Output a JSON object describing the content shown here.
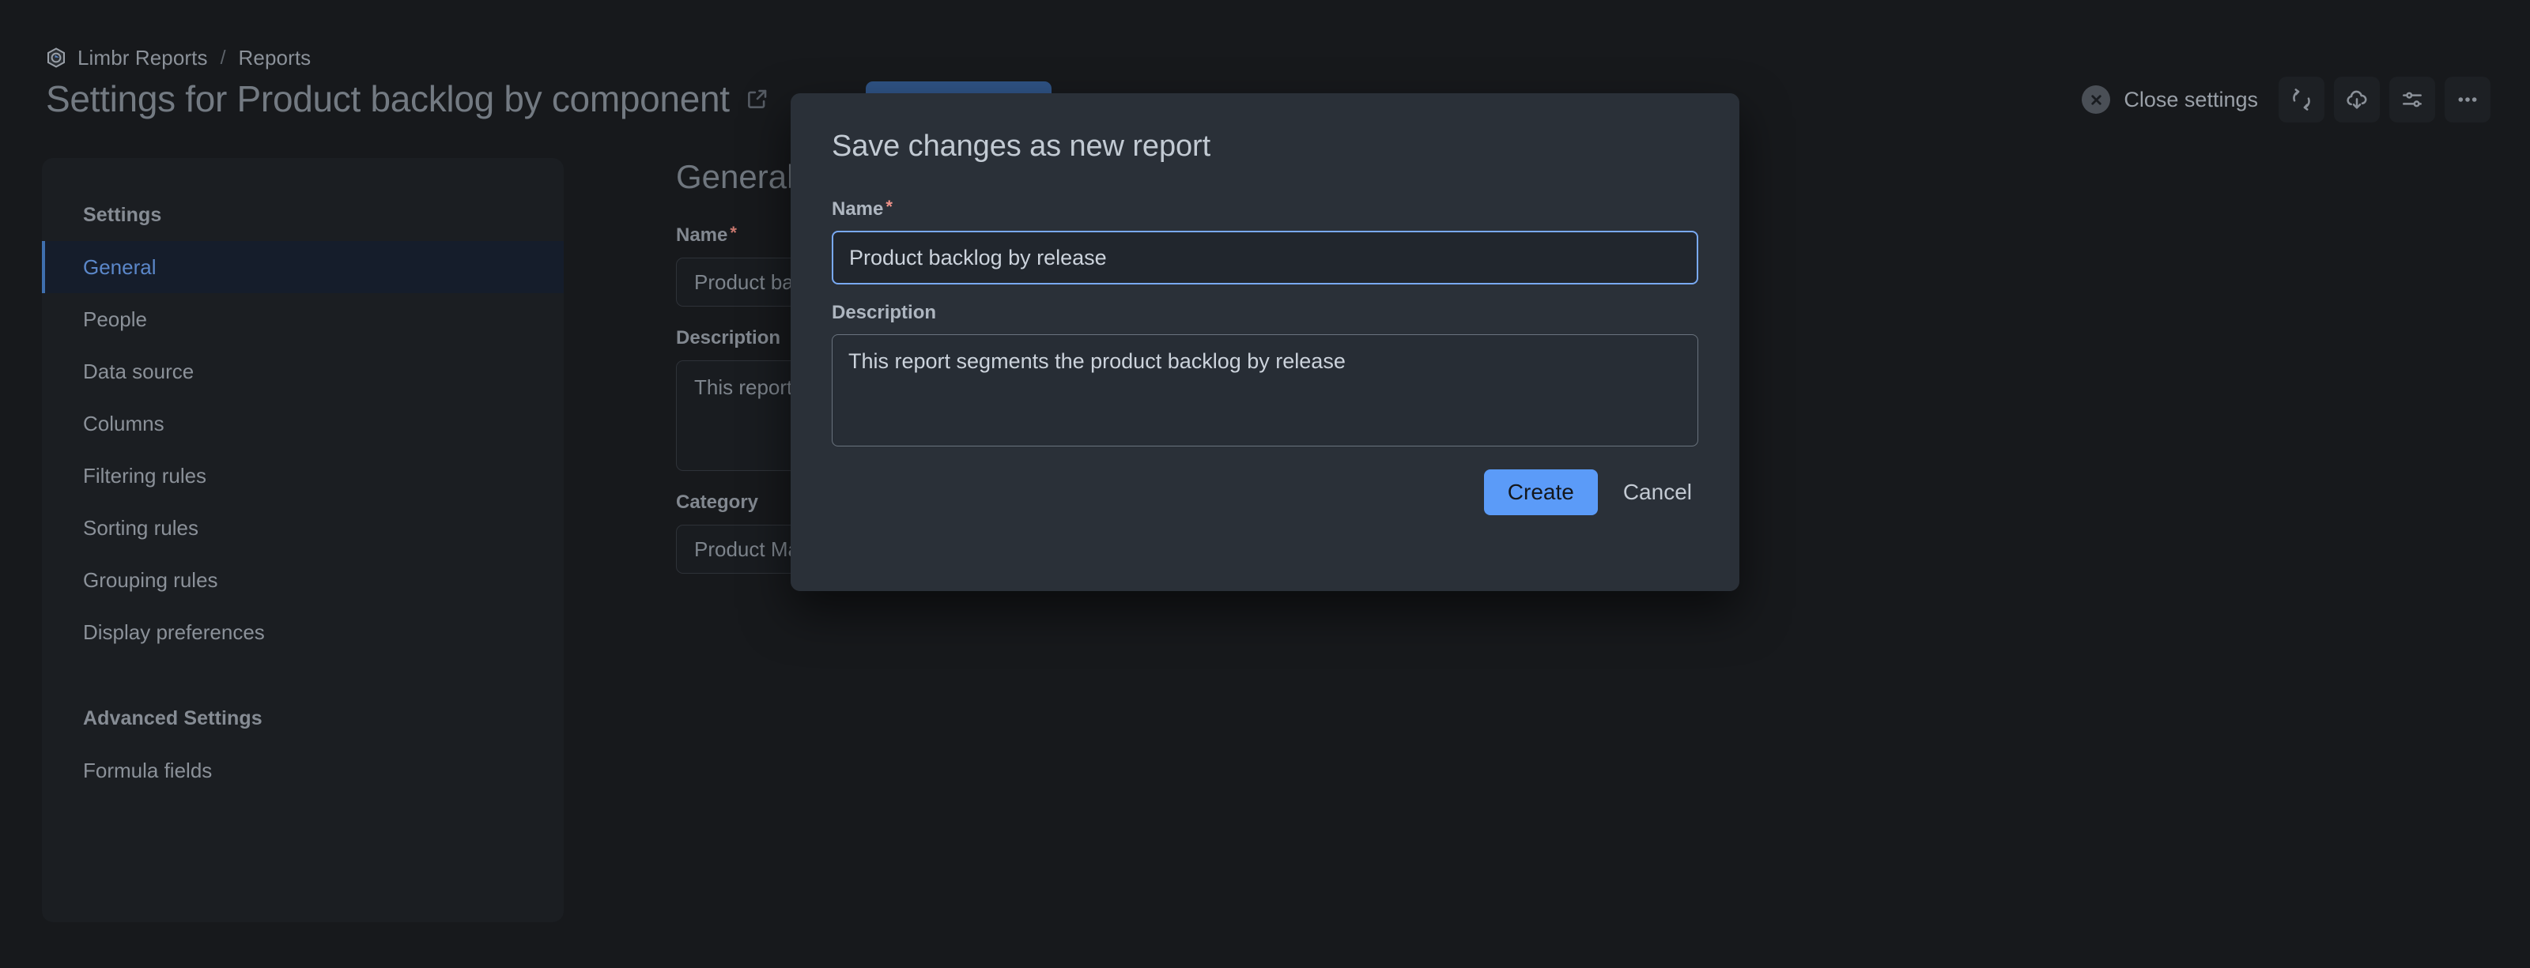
{
  "breadcrumb": {
    "logo_icon": "limbr-hexagon-logo-icon",
    "items": [
      "Limbr Reports",
      "Reports"
    ],
    "separator": "/"
  },
  "header": {
    "title": "Settings for Product backlog by component",
    "external_link_icon": "external-link-icon",
    "close_settings_label": "Close settings",
    "close_icon": "close-x-icon",
    "actions": [
      {
        "icon": "refresh-sync-icon"
      },
      {
        "icon": "cloud-download-icon"
      },
      {
        "icon": "sliders-settings-icon"
      },
      {
        "icon": "more-horizontal-icon"
      }
    ]
  },
  "sidebar": {
    "settings_title": "Settings",
    "items": [
      {
        "label": "General",
        "active": true
      },
      {
        "label": "People",
        "active": false
      },
      {
        "label": "Data source",
        "active": false
      },
      {
        "label": "Columns",
        "active": false
      },
      {
        "label": "Filtering rules",
        "active": false
      },
      {
        "label": "Sorting rules",
        "active": false
      },
      {
        "label": "Grouping rules",
        "active": false
      },
      {
        "label": "Display preferences",
        "active": false
      }
    ],
    "advanced_title": "Advanced Settings",
    "advanced_items": [
      {
        "label": "Formula fields",
        "active": false
      }
    ]
  },
  "main": {
    "heading": "General",
    "name_label": "Name",
    "required_mark": "*",
    "name_value": "Product backlog by component",
    "description_label": "Description",
    "description_value": "This report breaks down the product backlog by component",
    "category_label": "Category",
    "category_value": "Product Management"
  },
  "modal": {
    "title": "Save changes as new report",
    "name_label": "Name",
    "required_mark": "*",
    "name_value": "Product backlog by release",
    "description_label": "Description",
    "description_value": "This report segments the product backlog by release",
    "create_label": "Create",
    "cancel_label": "Cancel"
  },
  "colors": {
    "page_background": "#17191c",
    "panel_background": "#1b1e22",
    "modal_background": "#2a3038",
    "accent_blue": "#5b9bf8",
    "focus_border": "#79a9f2",
    "active_item": "#5b87c9",
    "required_star": "#f0938a"
  }
}
